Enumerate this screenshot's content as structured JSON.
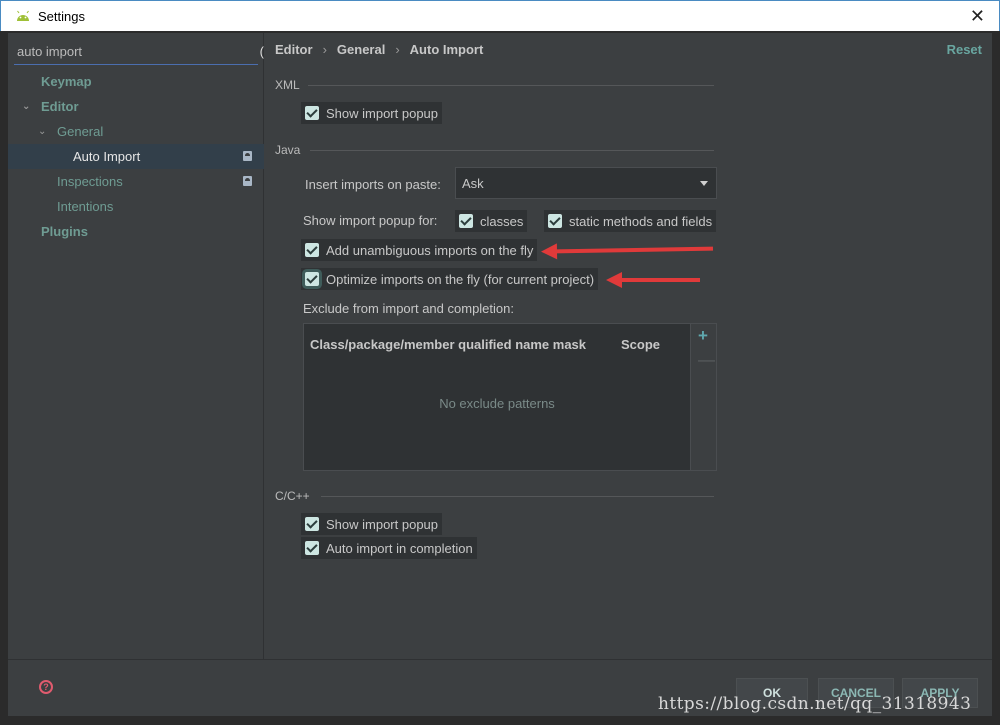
{
  "window": {
    "title": "Settings",
    "icon": "android-icon",
    "close_glyph": "✕"
  },
  "search": {
    "value": "auto import"
  },
  "sidebar": {
    "items": [
      {
        "label": "Keymap"
      },
      {
        "label": "Editor"
      },
      {
        "label": "General"
      },
      {
        "label": "Auto Import"
      },
      {
        "label": "Inspections"
      },
      {
        "label": "Intentions"
      },
      {
        "label": "Plugins"
      }
    ]
  },
  "header": {
    "breadcrumb": [
      "Editor",
      "General",
      "Auto Import"
    ],
    "reset_label": "Reset"
  },
  "xml": {
    "title": "XML",
    "show_import_popup": {
      "label": "Show import popup",
      "checked": true
    }
  },
  "java": {
    "title": "Java",
    "insert_on_paste_label": "Insert imports on paste:",
    "insert_on_paste_value": "Ask",
    "show_popup_for_label": "Show import popup for:",
    "classes": {
      "label": "classes",
      "checked": true
    },
    "static_members": {
      "label": "static methods and fields",
      "checked": true
    },
    "add_unambiguous": {
      "label": "Add unambiguous imports on the fly",
      "checked": true
    },
    "optimize_imports": {
      "label": "Optimize imports on the fly (for current project)",
      "checked": true
    },
    "exclude_label": "Exclude from import and completion:",
    "table": {
      "columns": [
        "Class/package/member qualified name mask",
        "Scope"
      ],
      "empty_text": "No exclude patterns",
      "add_glyph": "+",
      "remove_glyph": "—"
    }
  },
  "cpp": {
    "title": "C/C++",
    "show_import_popup": {
      "label": "Show import popup",
      "checked": true
    },
    "auto_import_completion": {
      "label": "Auto import in completion",
      "checked": true
    }
  },
  "footer": {
    "help_glyph": "?",
    "ok_label": "OK",
    "cancel_label": "CANCEL",
    "apply_label": "APPLY"
  },
  "watermark": "https://blog.csdn.net/qq_31318943",
  "colors": {
    "accent": "#69a6a0",
    "annotation_arrow": "#e03a3a",
    "checkbox": "#cde6e2"
  }
}
